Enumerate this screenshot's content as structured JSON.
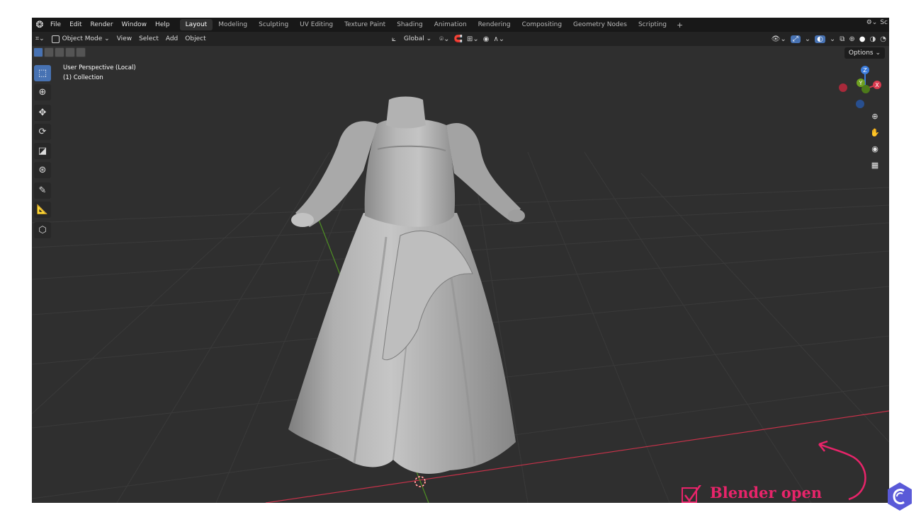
{
  "menu": {
    "items": [
      "File",
      "Edit",
      "Render",
      "Window",
      "Help"
    ],
    "workspaces": [
      "Layout",
      "Modeling",
      "Sculpting",
      "UV Editing",
      "Texture Paint",
      "Shading",
      "Animation",
      "Rendering",
      "Compositing",
      "Geometry Nodes",
      "Scripting"
    ],
    "active_workspace": "Layout",
    "add_tab": "+",
    "right_truncated": "Sc"
  },
  "header": {
    "mode": "Object Mode",
    "view": "View",
    "select": "Select",
    "add": "Add",
    "object": "Object",
    "orientation": "Global"
  },
  "viewport": {
    "perspective_label": "User Perspective (Local)",
    "collection_label": "(1) Collection",
    "options_label": "Options",
    "axis_labels": {
      "z": "Z",
      "y": "Y",
      "x": "X"
    }
  },
  "left_tools": [
    {
      "name": "select-box-tool",
      "icon": "cursor-select-icon"
    },
    {
      "name": "cursor-tool",
      "icon": "3d-cursor-icon"
    },
    {
      "name": "move-tool",
      "icon": "move-arrows-icon"
    },
    {
      "name": "rotate-tool",
      "icon": "rotate-icon"
    },
    {
      "name": "scale-tool",
      "icon": "scale-icon"
    },
    {
      "name": "transform-tool",
      "icon": "transform-icon"
    },
    {
      "name": "annotate-tool",
      "icon": "pencil-icon"
    },
    {
      "name": "measure-tool",
      "icon": "ruler-icon"
    },
    {
      "name": "add-cube-tool",
      "icon": "add-cube-icon"
    }
  ],
  "watermark": {
    "text": "Blender open"
  },
  "colors": {
    "viewport_bg": "#2f2f2f",
    "topbar_bg": "#181818",
    "header_bg": "#232323",
    "accent_blue": "#4772b3",
    "x_axis_red": "#d93a4f",
    "y_axis_green": "#6ea020",
    "z_axis_blue": "#3c7cdb",
    "watermark_pink": "#e8246a",
    "mesh_gray": "#b5b5b5"
  }
}
